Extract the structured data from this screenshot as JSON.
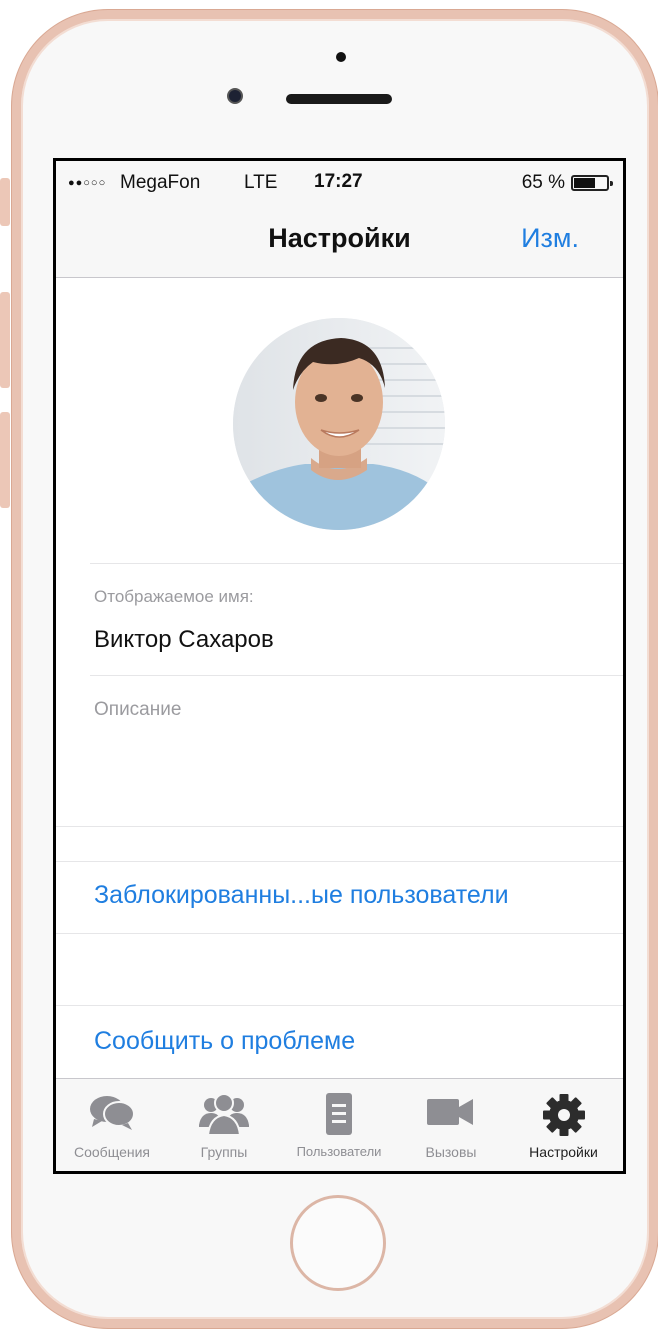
{
  "status_bar": {
    "signal": "●●○○○",
    "carrier": "MegaFon",
    "network": "LTE",
    "time": "17:27",
    "battery": "65 %",
    "battery_level": 0.65
  },
  "nav": {
    "title": "Настройки",
    "edit_label": "Изм."
  },
  "profile": {
    "display_name_label": "Отображаемое имя:",
    "display_name": "Виктор Сахаров",
    "description_placeholder": "Описание"
  },
  "links": {
    "blocked_users": "Заблокированны...ые пользователи",
    "report_problem": "Сообщить о проблеме"
  },
  "tabs": [
    {
      "label": "Сообщения",
      "icon": "chat-bubbles-icon"
    },
    {
      "label": "Группы",
      "icon": "groups-icon"
    },
    {
      "label": "Пользователи",
      "icon": "contacts-icon"
    },
    {
      "label": "Вызовы",
      "icon": "video-camera-icon"
    },
    {
      "label": "Настройки",
      "icon": "gear-icon",
      "active": true
    }
  ],
  "colors": {
    "accent": "#1f7ee0",
    "tab_inactive": "#8e8e93",
    "tab_active": "#222222"
  }
}
